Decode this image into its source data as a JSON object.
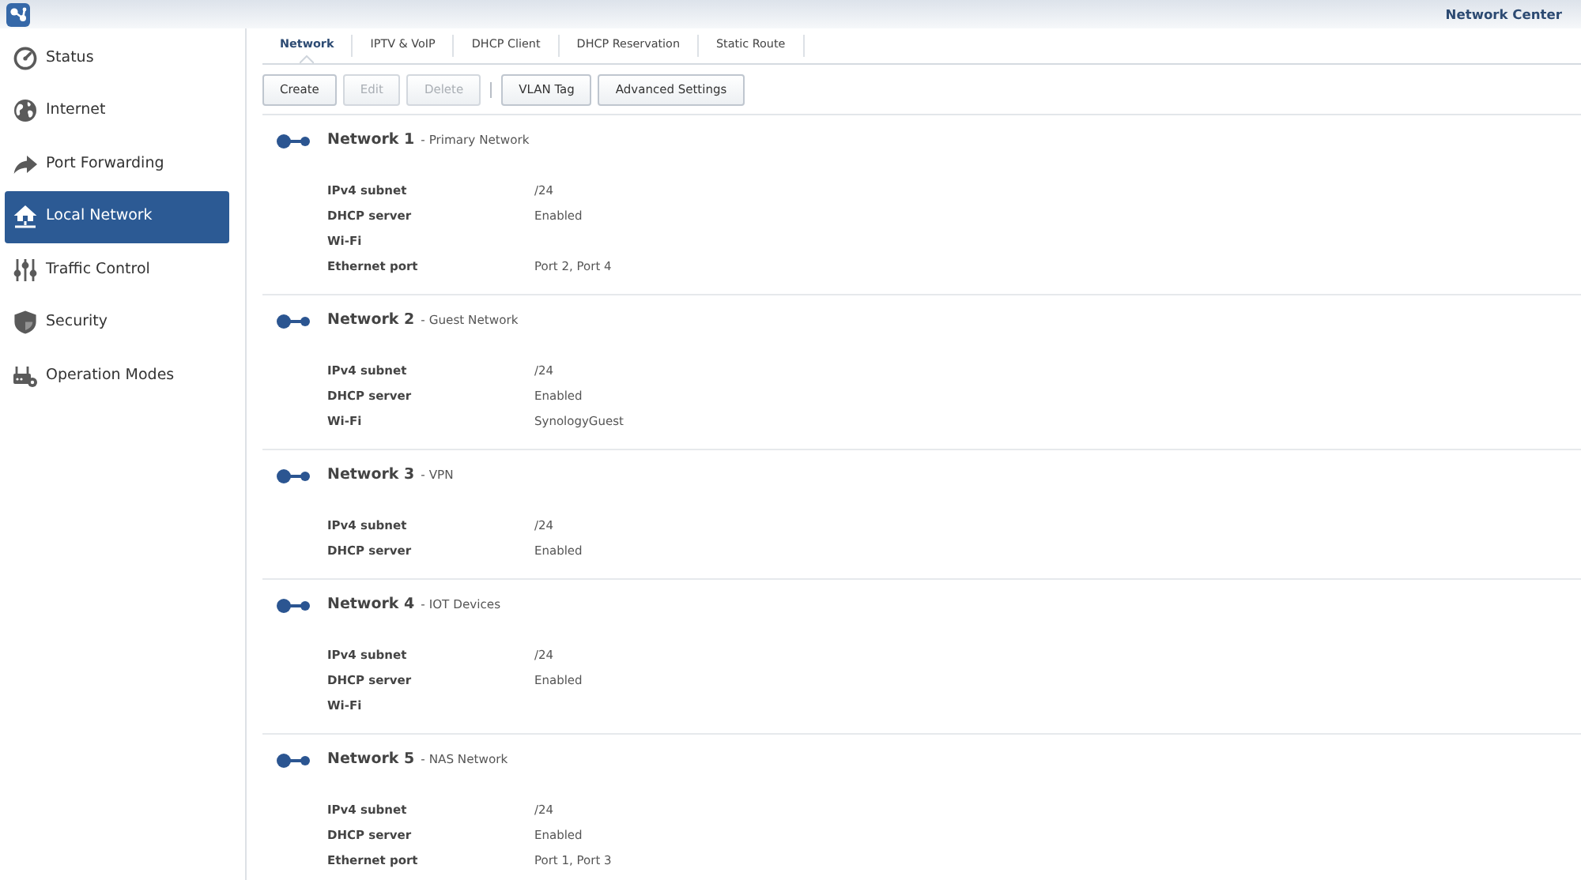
{
  "window": {
    "title": "Network Center"
  },
  "sidebar": {
    "items": [
      {
        "label": "Status",
        "selected": false
      },
      {
        "label": "Internet",
        "selected": false
      },
      {
        "label": "Port Forwarding",
        "selected": false
      },
      {
        "label": "Local Network",
        "selected": true
      },
      {
        "label": "Traffic Control",
        "selected": false
      },
      {
        "label": "Security",
        "selected": false
      },
      {
        "label": "Operation Modes",
        "selected": false
      }
    ]
  },
  "tabs": [
    {
      "label": "Network",
      "selected": true
    },
    {
      "label": "IPTV & VoIP",
      "selected": false
    },
    {
      "label": "DHCP Client",
      "selected": false
    },
    {
      "label": "DHCP Reservation",
      "selected": false
    },
    {
      "label": "Static Route",
      "selected": false
    }
  ],
  "toolbar": {
    "groups": [
      [
        {
          "label": "Create",
          "disabled": false
        },
        {
          "label": "Edit",
          "disabled": true
        },
        {
          "label": "Delete",
          "disabled": true
        }
      ],
      [
        {
          "label": "VLAN Tag",
          "disabled": false
        },
        {
          "label": "Advanced Settings",
          "disabled": false
        }
      ]
    ]
  },
  "networks": [
    {
      "name": "Network 1",
      "subtitle": "- Primary Network",
      "fields": [
        {
          "label": "IPv4 subnet",
          "value": "/24"
        },
        {
          "label": "DHCP server",
          "value": "Enabled"
        },
        {
          "label": "Wi-Fi"
        },
        {
          "label": "Ethernet port",
          "value": "Port 2, Port 4"
        }
      ]
    },
    {
      "name": "Network 2",
      "subtitle": "- Guest Network",
      "fields": [
        {
          "label": "IPv4 subnet",
          "value": "/24"
        },
        {
          "label": "DHCP server",
          "value": "Enabled"
        },
        {
          "label": "Wi-Fi",
          "value": "SynologyGuest"
        }
      ]
    },
    {
      "name": "Network 3",
      "subtitle": "- VPN",
      "fields": [
        {
          "label": "IPv4 subnet",
          "value": "/24"
        },
        {
          "label": "DHCP server",
          "value": "Enabled"
        }
      ]
    },
    {
      "name": "Network 4",
      "subtitle": "- IOT Devices",
      "fields": [
        {
          "label": "IPv4 subnet",
          "value": "/24"
        },
        {
          "label": "DHCP server",
          "value": "Enabled"
        },
        {
          "label": "Wi-Fi"
        }
      ]
    },
    {
      "name": "Network 5",
      "subtitle": "- NAS Network",
      "fields": [
        {
          "label": "IPv4 subnet",
          "value": "/24"
        },
        {
          "label": "DHCP server",
          "value": "Enabled"
        },
        {
          "label": "Ethernet port",
          "value": "Port 1, Port 3"
        }
      ]
    }
  ]
}
